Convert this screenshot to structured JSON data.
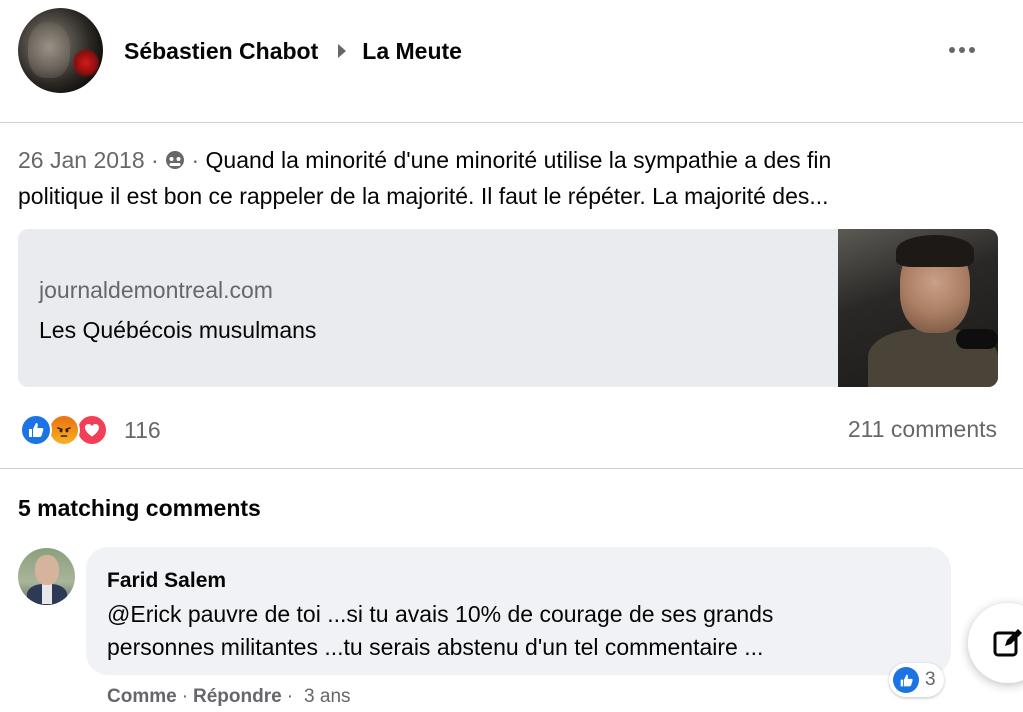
{
  "post": {
    "author": "Sébastien Chabot",
    "group": "La Meute",
    "date": "26 Jan 2018",
    "separator_1": "·",
    "separator_2": "·",
    "text_line_1": "Quand la minorité d'une minorité utilise la sympathie a des fin",
    "text_line_2": "politique il est bon ce rappeler de la majorité. Il faut le répéter. La majorité des..."
  },
  "link_preview": {
    "domain": "journaldemontreal.com",
    "title": "Les Québécois musulmans"
  },
  "stats": {
    "reaction_count": "116",
    "comment_count": "211 comments"
  },
  "reactions": [
    "like-icon",
    "angry-icon",
    "love-icon"
  ],
  "comments_section": {
    "heading": "5 matching comments"
  },
  "comment": {
    "author": "Farid Salem",
    "text_line_1": "@Erick pauvre de toi ...si tu avais 10% de courage de ses grands",
    "text_line_2": "personnes militantes ...tu serais abstenu d'un tel commentaire ...",
    "reaction_count": "3",
    "action_like": "Comme",
    "dot_1": "·",
    "action_reply": "Répondre",
    "dot_2": "·",
    "time": "3 ans"
  },
  "colors": {
    "like_blue": "#1b74e4",
    "text_primary": "#050505",
    "text_secondary": "#65676b",
    "bubble_bg": "#f0f2f5",
    "card_bg": "#e9ebee"
  }
}
